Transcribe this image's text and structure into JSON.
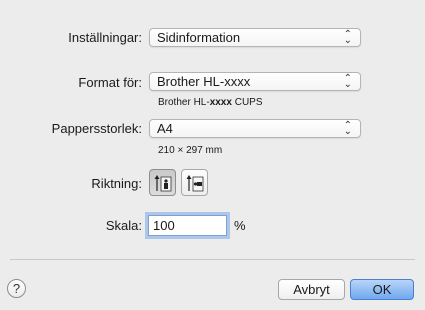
{
  "settings": {
    "label": "Inställningar:",
    "value": "Sidinformation"
  },
  "format": {
    "label": "Format för:",
    "value": "Brother HL-xxxx",
    "sub_prefix": "Brother HL-",
    "sub_bold": "xxxx",
    "sub_suffix": " CUPS"
  },
  "paper": {
    "label": "Pappersstorlek:",
    "value": "A4",
    "dimensions": "210 × 297 mm"
  },
  "orientation": {
    "label": "Riktning:",
    "options": [
      "portrait",
      "landscape"
    ],
    "selected": "portrait"
  },
  "scale": {
    "label": "Skala:",
    "value": "100",
    "unit": "%"
  },
  "footer": {
    "help_label": "?",
    "cancel_label": "Avbryt",
    "ok_label": "OK"
  },
  "icons": {
    "popup_arrows": "⬍",
    "portrait_icon": "portrait-orientation-icon",
    "landscape_icon": "landscape-orientation-icon",
    "help_icon": "question-mark-icon"
  },
  "colors": {
    "background": "#ececec",
    "focus_ring": "#78aaeb",
    "default_button": "#70a8ee"
  }
}
